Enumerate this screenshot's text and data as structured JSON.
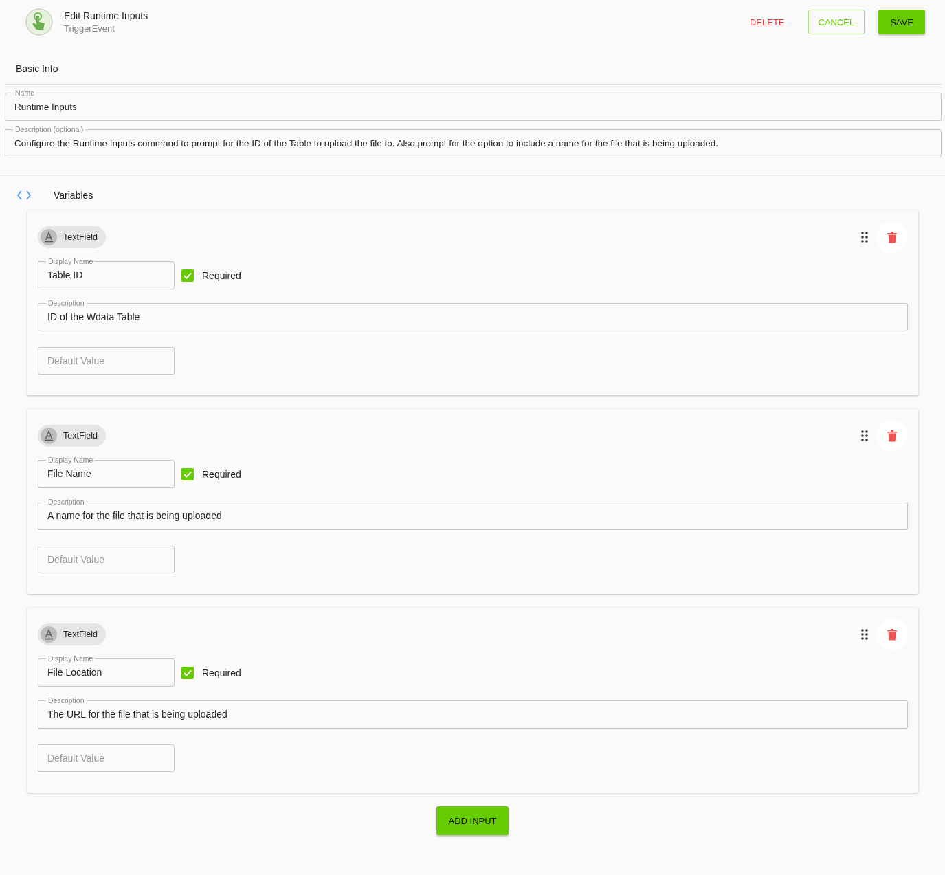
{
  "header": {
    "title": "Edit Runtime Inputs",
    "subtitle": "TriggerEvent",
    "buttons": [
      {
        "label": "DELETE",
        "kind": "text"
      },
      {
        "label": "CANCEL",
        "kind": "outlined"
      },
      {
        "label": "SAVE",
        "kind": "filled"
      }
    ]
  },
  "basic_info": {
    "heading": "Basic Info",
    "name": {
      "label": "Name",
      "value": "Runtime Inputs"
    },
    "description": {
      "label": "Description (optional)",
      "value": "Configure the Runtime Inputs command to prompt for the ID of the Table to upload the file to. Also prompt for the option to include a name for the file that is being uploaded."
    }
  },
  "variables": {
    "heading": "Variables",
    "items": [
      {
        "type": "TextField",
        "display_name": {
          "label": "Display Name",
          "value": "Table ID"
        },
        "required": {
          "label": "Required",
          "checked": true
        },
        "description": {
          "label": "Description",
          "value": "ID of the Wdata Table"
        },
        "default_value": {
          "placeholder": "Default Value"
        }
      },
      {
        "type": "TextField",
        "display_name": {
          "label": "Display Name",
          "value": "File Name"
        },
        "required": {
          "label": "Required",
          "checked": true
        },
        "description": {
          "label": "Description",
          "value": "A name for the file that is being uploaded"
        },
        "default_value": {
          "placeholder": "Default Value"
        }
      },
      {
        "type": "TextField",
        "display_name": {
          "label": "Display Name",
          "value": "File Location"
        },
        "required": {
          "label": "Required",
          "checked": true
        },
        "description": {
          "label": "Description",
          "value": "The URL for the file that is being uploaded"
        },
        "default_value": {
          "placeholder": "Default Value"
        }
      }
    ]
  },
  "add_button": {
    "label": "ADD INPUT"
  }
}
